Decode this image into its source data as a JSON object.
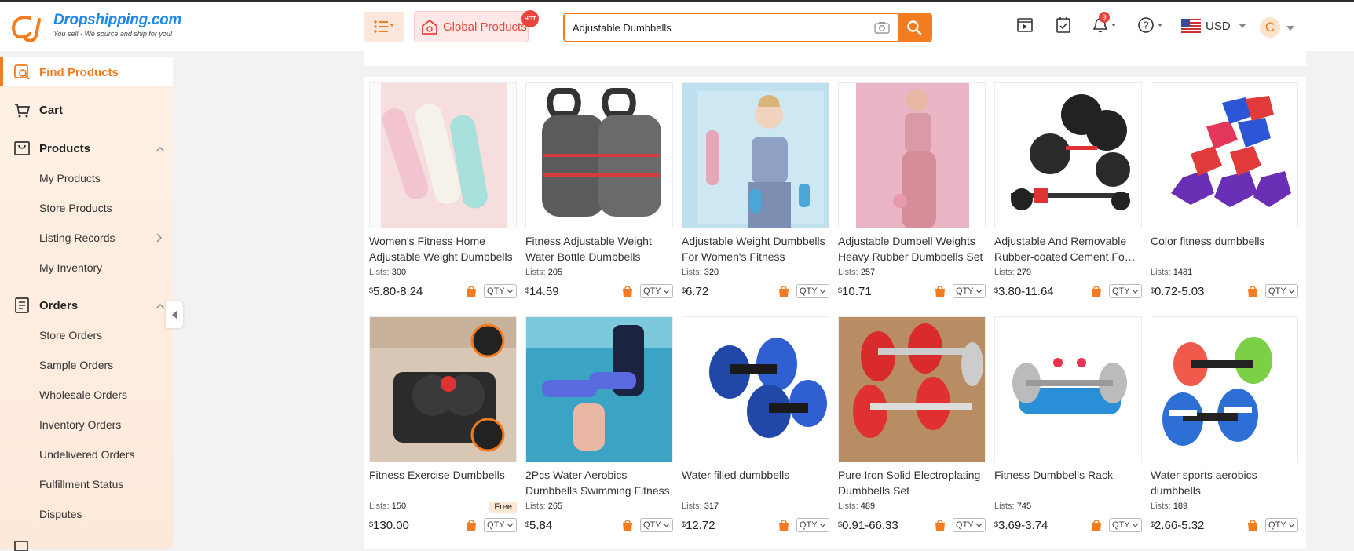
{
  "logo": {
    "brand": "Dropshipping.com",
    "tagline": "You sell - We source and ship for you!"
  },
  "header": {
    "global_label": "Global Products",
    "hot_badge": "HOT",
    "search": {
      "value": "Adjustable Dumbbells",
      "placeholder": ""
    },
    "notif_count": "9",
    "currency": "USD",
    "avatar_letter": "C"
  },
  "sidebar": {
    "find_products": "Find Products",
    "cart": "Cart",
    "products": "Products",
    "products_items": [
      "My Products",
      "Store Products",
      "Listing Records",
      "My Inventory"
    ],
    "orders": "Orders",
    "orders_items": [
      "Store Orders",
      "Sample Orders",
      "Wholesale Orders",
      "Inventory Orders",
      "Undelivered Orders",
      "Fulfillment Status",
      "Disputes"
    ]
  },
  "products": [
    {
      "title": "Women's Fitness Home Adjustable Weight Dumbbells",
      "lists_label": "Lists:",
      "lists": "300",
      "currency": "$",
      "price": "5.80-8.24",
      "qty": "QTY"
    },
    {
      "title": "Fitness Adjustable Weight Water Bottle Dumbbells",
      "lists_label": "Lists:",
      "lists": "205",
      "currency": "$",
      "price": "14.59",
      "qty": "QTY"
    },
    {
      "title": "Adjustable Weight Dumbbells For Women's Fitness",
      "lists_label": "Lists:",
      "lists": "320",
      "currency": "$",
      "price": "6.72",
      "qty": "QTY"
    },
    {
      "title": "Adjustable Dumbell Weights Heavy Rubber Dumbbells Set",
      "lists_label": "Lists:",
      "lists": "257",
      "currency": "$",
      "price": "10.71",
      "qty": "QTY"
    },
    {
      "title": "Adjustable And Removable Rubber-coated Cement Fo…",
      "lists_label": "Lists:",
      "lists": "279",
      "currency": "$",
      "price": "3.80-11.64",
      "qty": "QTY"
    },
    {
      "title": "Color fitness dumbbells",
      "lists_label": "Lists:",
      "lists": "1481",
      "currency": "$",
      "price": "0.72-5.03",
      "qty": "QTY"
    },
    {
      "title": "Fitness Exercise Dumbbells",
      "lists_label": "Lists:",
      "lists": "150",
      "currency": "$",
      "price": "130.00",
      "qty": "QTY",
      "free": "Free"
    },
    {
      "title": "2Pcs Water Aerobics Dumbbells Swimming Fitness",
      "lists_label": "Lists:",
      "lists": "265",
      "currency": "$",
      "price": "5.84",
      "qty": "QTY"
    },
    {
      "title": "Water filled dumbbells",
      "lists_label": "Lists:",
      "lists": "317",
      "currency": "$",
      "price": "12.72",
      "qty": "QTY"
    },
    {
      "title": "Pure Iron Solid Electroplating Dumbbells Set",
      "lists_label": "Lists:",
      "lists": "489",
      "currency": "$",
      "price": "0.91-66.33",
      "qty": "QTY"
    },
    {
      "title": "Fitness Dumbbells Rack",
      "lists_label": "Lists:",
      "lists": "745",
      "currency": "$",
      "price": "3.69-3.74",
      "qty": "QTY"
    },
    {
      "title": "Water sports aerobics dumbbells",
      "lists_label": "Lists:",
      "lists": "189",
      "currency": "$",
      "price": "2.66-5.32",
      "qty": "QTY"
    }
  ],
  "colors": {
    "accent": "#f47c20",
    "brand_blue": "#1e88e5",
    "hot_red": "#e8453c"
  }
}
